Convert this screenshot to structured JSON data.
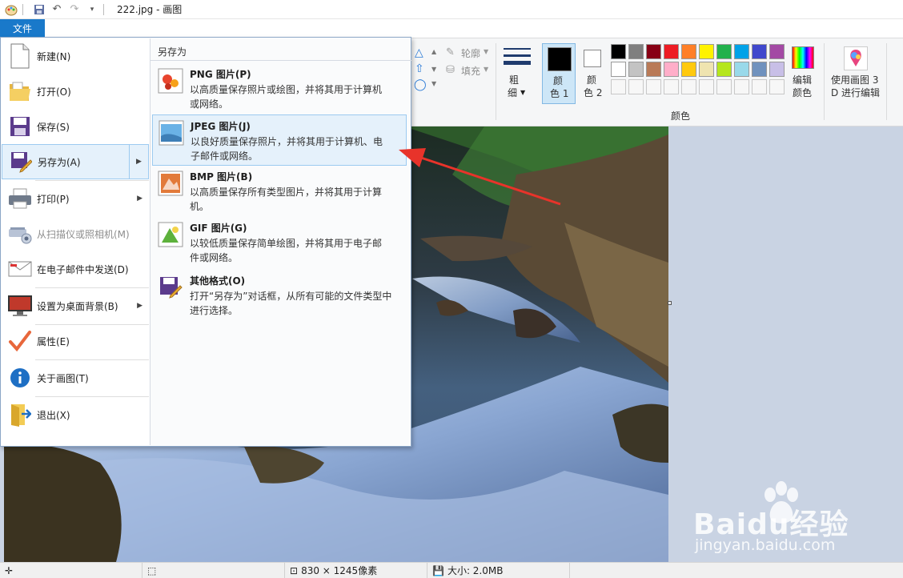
{
  "window": {
    "title": "222.jpg - 画图"
  },
  "ribbon": {
    "file_tab": "文件",
    "outline_label": "轮廓",
    "fill_label": "填充",
    "size_label_1": "粗",
    "size_label_2": "细",
    "color1_line1": "颜",
    "color1_line2": "色 1",
    "color2_line1": "颜",
    "color2_line2": "色 2",
    "edit_colors_line1": "编辑",
    "edit_colors_line2": "颜色",
    "paint3d_line1": "使用画图 3",
    "paint3d_line2": "D 进行编辑",
    "colors_group": "颜色",
    "colors_row1": [
      "#000000",
      "#7f7f7f",
      "#880015",
      "#ed1c24",
      "#ff7f27",
      "#fff200",
      "#22b14c",
      "#00a2e8",
      "#3f48cc",
      "#a349a4"
    ],
    "colors_row2": [
      "#ffffff",
      "#c3c3c3",
      "#b97a57",
      "#ffaec9",
      "#ffc90e",
      "#efe4b0",
      "#b5e61d",
      "#99d9ea",
      "#7092be",
      "#c8bfe7"
    ]
  },
  "file_menu": {
    "items": [
      {
        "label": "新建(N)",
        "icon": "new-file-icon"
      },
      {
        "label": "打开(O)",
        "icon": "open-folder-icon"
      },
      {
        "label": "保存(S)",
        "icon": "save-disk-icon"
      },
      {
        "label": "另存为(A)",
        "icon": "save-as-icon"
      },
      {
        "label": "打印(P)",
        "icon": "printer-icon"
      },
      {
        "label": "从扫描仪或照相机(M)",
        "icon": "scanner-icon"
      },
      {
        "label": "在电子邮件中发送(D)",
        "icon": "email-icon"
      },
      {
        "label": "设置为桌面背景(B)",
        "icon": "desktop-icon"
      },
      {
        "label": "属性(E)",
        "icon": "checkmark-icon"
      },
      {
        "label": "关于画图(T)",
        "icon": "info-icon"
      },
      {
        "label": "退出(X)",
        "icon": "exit-icon"
      }
    ],
    "save_as_header": "另存为",
    "save_as_options": [
      {
        "title": "PNG 图片(P)",
        "desc_1": "以高质量保存照片或绘图，并将其用于计算机",
        "desc_2": "或网络。",
        "icon": "png-image-icon"
      },
      {
        "title": "JPEG 图片(J)",
        "desc_1": "以良好质量保存照片，并将其用于计算机、电",
        "desc_2": "子邮件或网络。",
        "icon": "jpeg-image-icon"
      },
      {
        "title": "BMP 图片(B)",
        "desc_1": "以高质量保存所有类型图片，并将其用于计算",
        "desc_2": "机。",
        "icon": "bmp-image-icon"
      },
      {
        "title": "GIF 图片(G)",
        "desc_1": "以较低质量保存简单绘图，并将其用于电子邮",
        "desc_2": "件或网络。",
        "icon": "gif-image-icon"
      },
      {
        "title": "其他格式(O)",
        "desc_1": "打开“另存为”对话框，从所有可能的文件类型中",
        "desc_2": "进行选择。",
        "icon": "other-formats-icon"
      }
    ]
  },
  "status": {
    "dimensions": "830 × 1245像素",
    "size": "大小: 2.0MB"
  },
  "watermark": {
    "brand": "Baidu经验",
    "url": "jingyan.baidu.com"
  }
}
